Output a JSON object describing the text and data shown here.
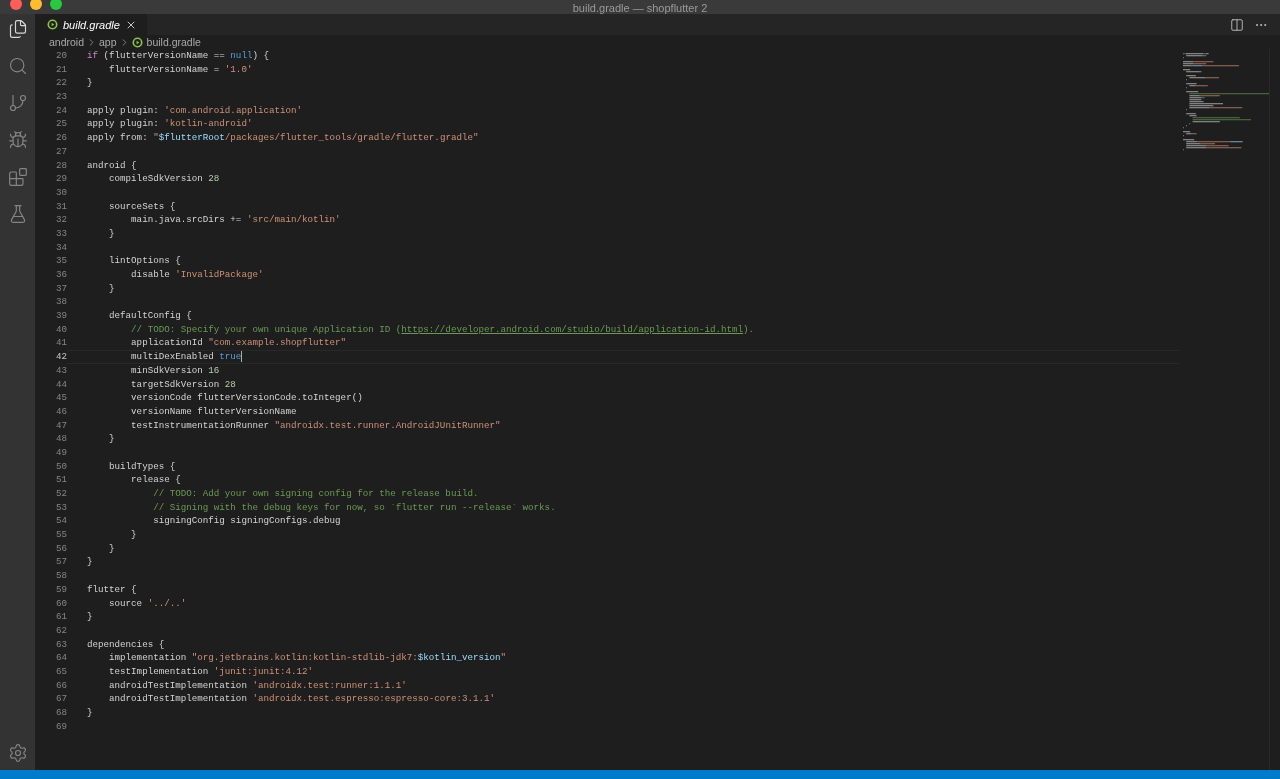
{
  "window": {
    "title": "build.gradle — shopflutter 2"
  },
  "tabs": [
    {
      "label": "build.gradle",
      "selected": true,
      "preview": true
    }
  ],
  "breadcrumb": [
    "android",
    "app",
    "build.gradle"
  ],
  "lines": [
    {
      "number": "20",
      "cursor": false,
      "tokens": [
        {
          "kind": "keyword",
          "text": "if"
        },
        {
          "kind": "plain",
          "text": " (flutterVersionName == "
        },
        {
          "kind": "constant",
          "text": "null"
        },
        {
          "kind": "plain",
          "text": ") {"
        }
      ]
    },
    {
      "number": "21",
      "cursor": false,
      "tokens": [
        {
          "kind": "plain",
          "text": "    flutterVersionName = "
        },
        {
          "kind": "string",
          "text": "'1.0'"
        }
      ]
    },
    {
      "number": "22",
      "cursor": false,
      "tokens": [
        {
          "kind": "plain",
          "text": "}"
        }
      ]
    },
    {
      "number": "23",
      "cursor": false
    },
    {
      "number": "24",
      "cursor": false,
      "tokens": [
        {
          "kind": "plain",
          "text": "apply plugin: "
        },
        {
          "kind": "string",
          "text": "'com.android.application'"
        }
      ]
    },
    {
      "number": "25",
      "cursor": false,
      "tokens": [
        {
          "kind": "plain",
          "text": "apply plugin: "
        },
        {
          "kind": "string",
          "text": "'kotlin-android'"
        }
      ]
    },
    {
      "number": "26",
      "cursor": false,
      "tokens": [
        {
          "kind": "plain",
          "text": "apply from: "
        },
        {
          "kind": "string",
          "text": "\""
        },
        {
          "kind": "variable",
          "text": "$flutterRoot"
        },
        {
          "kind": "string",
          "text": "/packages/flutter_tools/gradle/flutter.gradle\""
        }
      ]
    },
    {
      "number": "27",
      "cursor": false
    },
    {
      "number": "28",
      "cursor": false,
      "tokens": [
        {
          "kind": "plain",
          "text": "android {"
        }
      ]
    },
    {
      "number": "29",
      "cursor": false,
      "tokens": [
        {
          "kind": "plain",
          "text": "    compileSdkVersion "
        },
        {
          "kind": "number",
          "text": "28"
        }
      ]
    },
    {
      "number": "30",
      "cursor": false
    },
    {
      "number": "31",
      "cursor": false,
      "tokens": [
        {
          "kind": "plain",
          "text": "    sourceSets {"
        }
      ]
    },
    {
      "number": "32",
      "cursor": false,
      "tokens": [
        {
          "kind": "plain",
          "text": "        main.java.srcDirs += "
        },
        {
          "kind": "string",
          "text": "'src/main/kotlin'"
        }
      ]
    },
    {
      "number": "33",
      "cursor": false,
      "tokens": [
        {
          "kind": "plain",
          "text": "    }"
        }
      ]
    },
    {
      "number": "34",
      "cursor": false
    },
    {
      "number": "35",
      "cursor": false,
      "tokens": [
        {
          "kind": "plain",
          "text": "    lintOptions {"
        }
      ]
    },
    {
      "number": "36",
      "cursor": false,
      "tokens": [
        {
          "kind": "plain",
          "text": "        disable "
        },
        {
          "kind": "string",
          "text": "'InvalidPackage'"
        }
      ]
    },
    {
      "number": "37",
      "cursor": false,
      "tokens": [
        {
          "kind": "plain",
          "text": "    }"
        }
      ]
    },
    {
      "number": "38",
      "cursor": false
    },
    {
      "number": "39",
      "cursor": false,
      "tokens": [
        {
          "kind": "plain",
          "text": "    defaultConfig {"
        }
      ]
    },
    {
      "number": "40",
      "cursor": false,
      "tokens": [
        {
          "kind": "comment",
          "text": "        // TODO: Specify your own unique Application ID ("
        },
        {
          "kind": "link",
          "text": "https://developer.android.com/studio/build/application-id.html"
        },
        {
          "kind": "comment",
          "text": ")."
        }
      ]
    },
    {
      "number": "41",
      "cursor": false,
      "tokens": [
        {
          "kind": "plain",
          "text": "        applicationId "
        },
        {
          "kind": "string",
          "text": "\"com.example.shopflutter\""
        }
      ]
    },
    {
      "number": "42",
      "cursor": true,
      "tokens": [
        {
          "kind": "plain",
          "text": "        multiDexEnabled "
        },
        {
          "kind": "constant",
          "text": "true"
        }
      ]
    },
    {
      "number": "43",
      "cursor": false,
      "tokens": [
        {
          "kind": "plain",
          "text": "        minSdkVersion "
        },
        {
          "kind": "number",
          "text": "16"
        }
      ]
    },
    {
      "number": "44",
      "cursor": false,
      "tokens": [
        {
          "kind": "plain",
          "text": "        targetSdkVersion "
        },
        {
          "kind": "number",
          "text": "28"
        }
      ]
    },
    {
      "number": "45",
      "cursor": false,
      "tokens": [
        {
          "kind": "plain",
          "text": "        versionCode flutterVersionCode.toInteger()"
        }
      ]
    },
    {
      "number": "46",
      "cursor": false,
      "tokens": [
        {
          "kind": "plain",
          "text": "        versionName flutterVersionName"
        }
      ]
    },
    {
      "number": "47",
      "cursor": false,
      "tokens": [
        {
          "kind": "plain",
          "text": "        testInstrumentationRunner "
        },
        {
          "kind": "string",
          "text": "\"androidx.test.runner.AndroidJUnitRunner\""
        }
      ]
    },
    {
      "number": "48",
      "cursor": false,
      "tokens": [
        {
          "kind": "plain",
          "text": "    }"
        }
      ]
    },
    {
      "number": "49",
      "cursor": false
    },
    {
      "number": "50",
      "cursor": false,
      "tokens": [
        {
          "kind": "plain",
          "text": "    buildTypes {"
        }
      ]
    },
    {
      "number": "51",
      "cursor": false,
      "tokens": [
        {
          "kind": "plain",
          "text": "        release {"
        }
      ]
    },
    {
      "number": "52",
      "cursor": false,
      "tokens": [
        {
          "kind": "comment",
          "text": "            // TODO: Add your own signing config for the release build."
        }
      ]
    },
    {
      "number": "53",
      "cursor": false,
      "tokens": [
        {
          "kind": "comment",
          "text": "            // Signing with the debug keys for now, so `flutter run --release` works."
        }
      ]
    },
    {
      "number": "54",
      "cursor": false,
      "tokens": [
        {
          "kind": "plain",
          "text": "            signingConfig signingConfigs.debug"
        }
      ]
    },
    {
      "number": "55",
      "cursor": false,
      "tokens": [
        {
          "kind": "plain",
          "text": "        }"
        }
      ]
    },
    {
      "number": "56",
      "cursor": false,
      "tokens": [
        {
          "kind": "plain",
          "text": "    }"
        }
      ]
    },
    {
      "number": "57",
      "cursor": false,
      "tokens": [
        {
          "kind": "plain",
          "text": "}"
        }
      ]
    },
    {
      "number": "58",
      "cursor": false
    },
    {
      "number": "59",
      "cursor": false,
      "tokens": [
        {
          "kind": "plain",
          "text": "flutter {"
        }
      ]
    },
    {
      "number": "60",
      "cursor": false,
      "tokens": [
        {
          "kind": "plain",
          "text": "    source "
        },
        {
          "kind": "string",
          "text": "'../..'"
        }
      ]
    },
    {
      "number": "61",
      "cursor": false,
      "tokens": [
        {
          "kind": "plain",
          "text": "}"
        }
      ]
    },
    {
      "number": "62",
      "cursor": false
    },
    {
      "number": "63",
      "cursor": false,
      "tokens": [
        {
          "kind": "plain",
          "text": "dependencies {"
        }
      ]
    },
    {
      "number": "64",
      "cursor": false,
      "tokens": [
        {
          "kind": "plain",
          "text": "    implementation "
        },
        {
          "kind": "string",
          "text": "\"org.jetbrains.kotlin:kotlin-stdlib-jdk7:"
        },
        {
          "kind": "variable",
          "text": "$kotlin_version"
        },
        {
          "kind": "string",
          "text": "\""
        }
      ]
    },
    {
      "number": "65",
      "cursor": false,
      "tokens": [
        {
          "kind": "plain",
          "text": "    testImplementation "
        },
        {
          "kind": "string",
          "text": "'junit:junit:4.12'"
        }
      ]
    },
    {
      "number": "66",
      "cursor": false,
      "tokens": [
        {
          "kind": "plain",
          "text": "    androidTestImplementation "
        },
        {
          "kind": "string",
          "text": "'androidx.test:runner:1.1.1'"
        }
      ]
    },
    {
      "number": "67",
      "cursor": false,
      "tokens": [
        {
          "kind": "plain",
          "text": "    androidTestImplementation "
        },
        {
          "kind": "string",
          "text": "'androidx.test.espresso:espresso-core:3.1.1'"
        }
      ]
    },
    {
      "number": "68",
      "cursor": false,
      "tokens": [
        {
          "kind": "plain",
          "text": "}"
        }
      ]
    },
    {
      "number": "69",
      "cursor": false
    }
  ]
}
